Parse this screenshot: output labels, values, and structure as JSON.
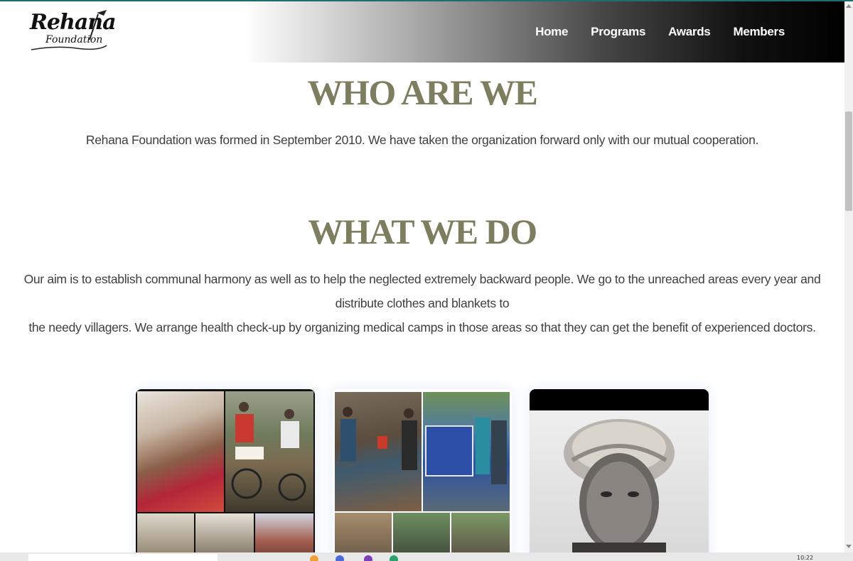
{
  "brand": {
    "logo_line1": "Rehana",
    "logo_line2": "Foundation"
  },
  "nav": {
    "items": [
      "Home",
      "Programs",
      "Awards",
      "Members"
    ]
  },
  "sections": {
    "who": {
      "title": "WHO ARE WE",
      "text": "Rehana Foundation was formed in September 2010. We have taken the organization forward only with our mutual cooperation."
    },
    "what": {
      "title": "WHAT WE DO",
      "text_line1": "Our aim is to establish communal harmony as well as to help the neglected extremely backward people. We go to the unreached areas every year and distribute clothes and blankets to",
      "text_line2": "the needy villagers. We arrange health check-up by organizing medical camps in those areas so that they can get the benefit of experienced doctors."
    }
  },
  "taskbar": {
    "time": "10:22"
  },
  "colors": {
    "heading": "#7d7d5f",
    "body_text": "#3e3e3e",
    "nav_text": "#ffffff",
    "accent": "#1e6f6a"
  }
}
